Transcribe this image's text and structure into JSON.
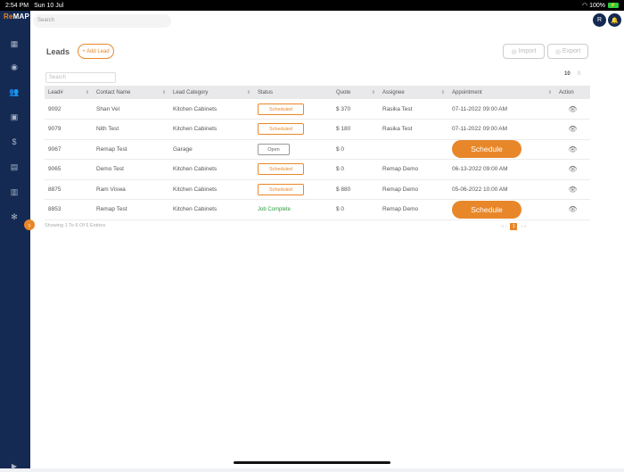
{
  "statusbar": {
    "time": "2:54 PM",
    "date": "Sun 10 Jul",
    "battery": "100%"
  },
  "app": {
    "logo_prefix": "Re",
    "logo_suffix": "MAP"
  },
  "topbar": {
    "search_placeholder": "Search",
    "avatar_initial": "R"
  },
  "page": {
    "title": "Leads",
    "add_label": "+ Add Lead",
    "import_label": "Import",
    "export_label": "Export",
    "table_search_placeholder": "Search",
    "page_size": "10",
    "page_size_other": "0"
  },
  "table": {
    "headers": [
      "Lead#",
      "Contact Name",
      "Lead Category",
      "Status",
      "Quote",
      "Assignee",
      "Appointment",
      "Action"
    ],
    "rows": [
      {
        "lead": "9092",
        "contact": "Shan Vel",
        "category": "Kitchen Cabinets",
        "status": "Scheduled",
        "quote": "$ 370",
        "assignee": "Rasika Test",
        "appointment": "07-11-2022 09:00 AM"
      },
      {
        "lead": "9079",
        "contact": "Nith Test",
        "category": "Kitchen Cabinets",
        "status": "Scheduled",
        "quote": "$ 180",
        "assignee": "Rasika Test",
        "appointment": "07-11-2022 09:00 AM"
      },
      {
        "lead": "9067",
        "contact": "Remap Test",
        "category": "Garage",
        "status": "Open",
        "quote": "$ 0",
        "assignee": "",
        "appointment": "Schedule"
      },
      {
        "lead": "9065",
        "contact": "Demo Test",
        "category": "Kitchen Cabinets",
        "status": "Scheduled",
        "quote": "$ 0",
        "assignee": "Remap Demo",
        "appointment": "06-13-2022 09:00 AM"
      },
      {
        "lead": "8875",
        "contact": "Ram Viswa",
        "category": "Kitchen Cabinets",
        "status": "Scheduled",
        "quote": "$ 880",
        "assignee": "Remap Demo",
        "appointment": "05-06-2022 10:00 AM"
      },
      {
        "lead": "8853",
        "contact": "Remap Test",
        "category": "Kitchen Cabinets",
        "status": "Job Complete",
        "quote": "$ 0",
        "assignee": "Remap Demo",
        "appointment": "Schedule"
      }
    ]
  },
  "footer": {
    "info": "Showing 1 To 6 Of 6 Entries",
    "current_page": "1"
  },
  "colors": {
    "accent": "#e8872a",
    "sidebar": "#152a52",
    "complete": "#2e9c3e"
  }
}
